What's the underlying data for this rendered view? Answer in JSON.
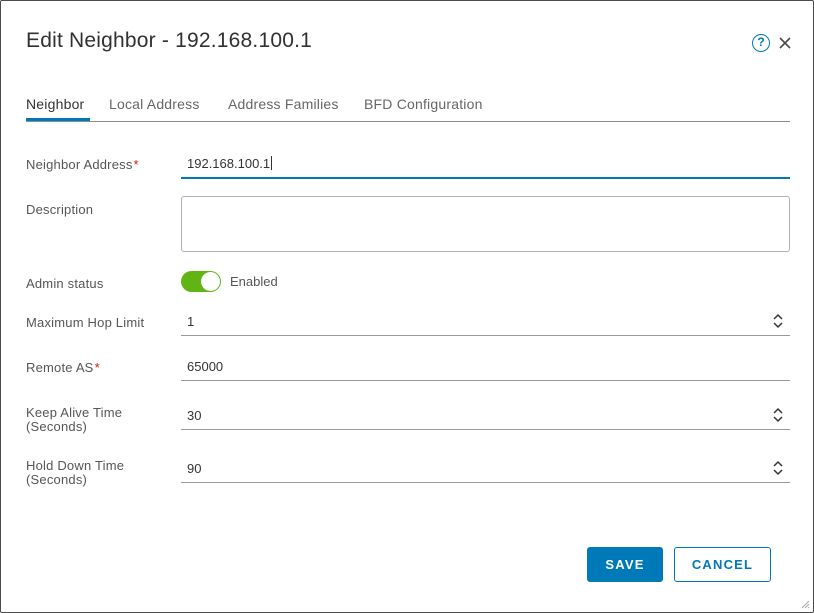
{
  "dialog": {
    "title": "Edit Neighbor - 192.168.100.1",
    "help_icon": "help-circle-icon",
    "close_icon": "close-icon"
  },
  "tabs": [
    {
      "label": "Neighbor",
      "active": true
    },
    {
      "label": "Local Address",
      "active": false
    },
    {
      "label": "Address Families",
      "active": false
    },
    {
      "label": "BFD Configuration",
      "active": false
    }
  ],
  "form": {
    "neighbor_address": {
      "label": "Neighbor Address",
      "required_mark": "*",
      "value": "192.168.100.1"
    },
    "description": {
      "label": "Description",
      "value": ""
    },
    "admin_status": {
      "label": "Admin status",
      "toggle_text": "Enabled",
      "enabled": true
    },
    "max_hop_limit": {
      "label": "Maximum Hop Limit",
      "value": "1"
    },
    "remote_as": {
      "label": "Remote AS",
      "required_mark": "*",
      "value": "65000"
    },
    "keep_alive": {
      "label_line1": "Keep Alive Time",
      "label_line2": "(Seconds)",
      "value": "30"
    },
    "hold_down": {
      "label_line1": "Hold Down Time",
      "label_line2": "(Seconds)",
      "value": "90"
    }
  },
  "buttons": {
    "save": "SAVE",
    "cancel": "CANCEL"
  },
  "colors": {
    "accent": "#0079b8",
    "toggle_on": "#60b515",
    "required": "#c92100"
  }
}
